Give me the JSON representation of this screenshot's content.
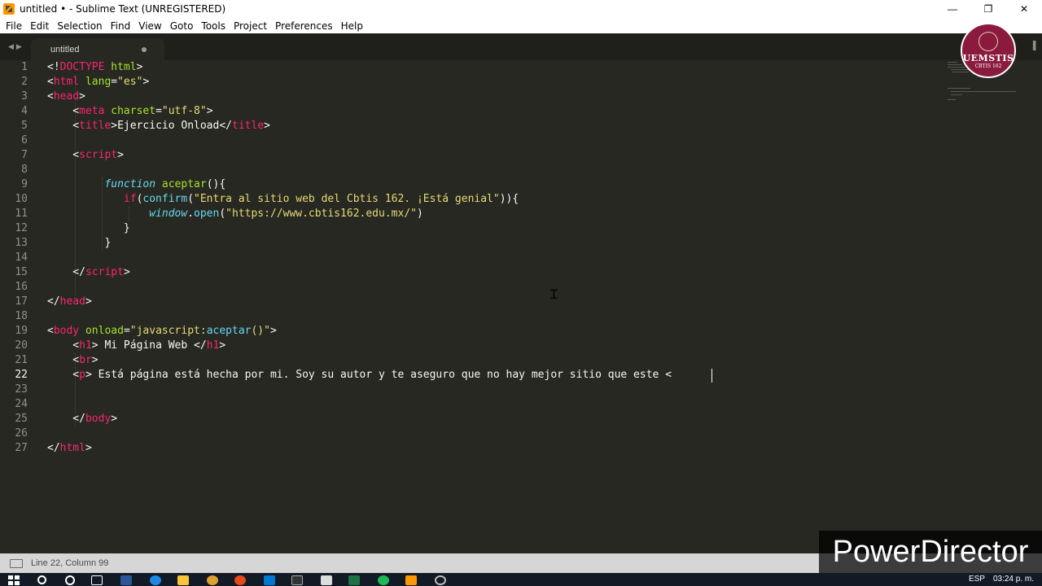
{
  "window": {
    "title": "untitled • - Sublime Text (UNREGISTERED)",
    "controls": {
      "minimize": "—",
      "restore": "❐",
      "close": "✕"
    }
  },
  "menu": [
    "File",
    "Edit",
    "Selection",
    "Find",
    "View",
    "Goto",
    "Tools",
    "Project",
    "Preferences",
    "Help"
  ],
  "tabs": [
    {
      "label": "untitled",
      "dirty": true
    }
  ],
  "editor": {
    "line_numbers": [
      "1",
      "2",
      "3",
      "4",
      "5",
      "6",
      "7",
      "8",
      "9",
      "10",
      "11",
      "12",
      "13",
      "14",
      "15",
      "16",
      "17",
      "18",
      "19",
      "20",
      "21",
      "22",
      "23",
      "24",
      "25",
      "26",
      "27"
    ],
    "active_line": 22
  },
  "logo": {
    "text": "UEMSTIS",
    "sub": "CBTIS 162"
  },
  "status": {
    "position": "Line 22, Column 99"
  },
  "watermark": "PowerDirector",
  "taskbar": {
    "lang": "ESP",
    "time": "03:24 p. m."
  },
  "colors": {
    "background": "#272822",
    "tag": "#f92672",
    "attr": "#a6e22e",
    "string": "#e6db74",
    "keyword": "#66d9ef"
  }
}
